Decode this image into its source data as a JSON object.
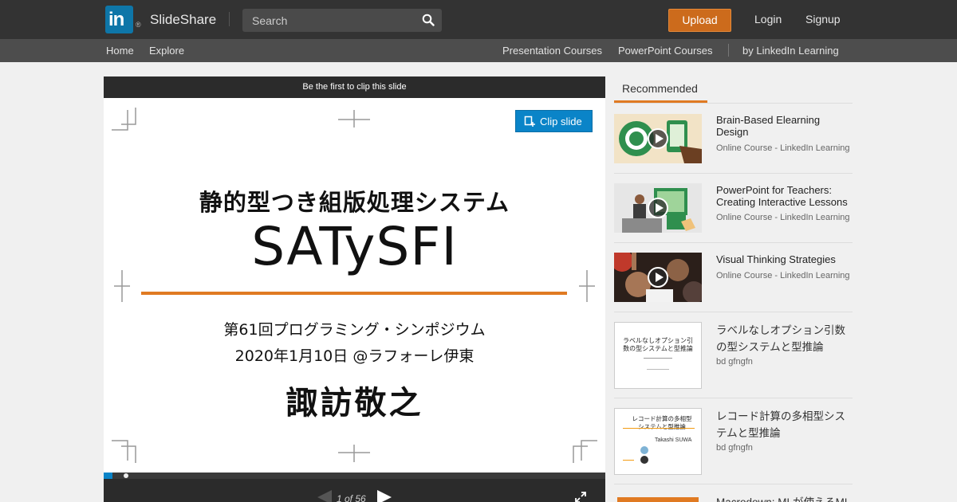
{
  "header": {
    "logo_mark": "in",
    "logo_reg": "®",
    "logo_text": "SlideShare",
    "search_placeholder": "Search",
    "upload_label": "Upload",
    "login_label": "Login",
    "signup_label": "Signup"
  },
  "subnav": {
    "home": "Home",
    "explore": "Explore",
    "presentation_courses": "Presentation Courses",
    "powerpoint_courses": "PowerPoint Courses",
    "linkedin_learning": "by LinkedIn Learning"
  },
  "player": {
    "clip_hint": "Be the first to clip this slide",
    "clip_button": "Clip slide",
    "page_counter": "1 of 56",
    "progress_fraction": 0.018
  },
  "slide": {
    "line1": "静的型つき組版処理システム",
    "line2": "SATySFI",
    "line3": "第61回プログラミング・シンポジウム",
    "line4": "2020年1月10日 @ラフォーレ伊東",
    "line5": "諏訪敬之"
  },
  "recommended": {
    "tab_label": "Recommended",
    "items": [
      {
        "title": "Brain-Based Elearning Design",
        "subtitle": "Online Course - LinkedIn Learning"
      },
      {
        "title": "PowerPoint for Teachers: Creating Interactive Lessons",
        "subtitle": "Online Course - LinkedIn Learning"
      },
      {
        "title": "Visual Thinking Strategies",
        "subtitle": "Online Course - LinkedIn Learning"
      },
      {
        "title": "ラベルなしオプション引数の型システムと型推論",
        "subtitle": "bd gfngfn",
        "thumb_title": "ラベルなしオプション引数の型システムと型推論"
      },
      {
        "title": "レコード計算の多相型システムと型推論",
        "subtitle": "bd gfngfn",
        "thumb_title": "レコード計算の多相型システムと型推論",
        "thumb_author": "Takashi SUWA"
      },
      {
        "title": "Macrodown: MLが使えるML"
      }
    ]
  },
  "colors": {
    "topbar": "#333333",
    "subbar": "#4d4d4d",
    "upload": "#cc6b1c",
    "linkedin_blue": "#0e76a8",
    "clip_blue": "#0a84c8",
    "accent_orange": "#e07a22"
  }
}
